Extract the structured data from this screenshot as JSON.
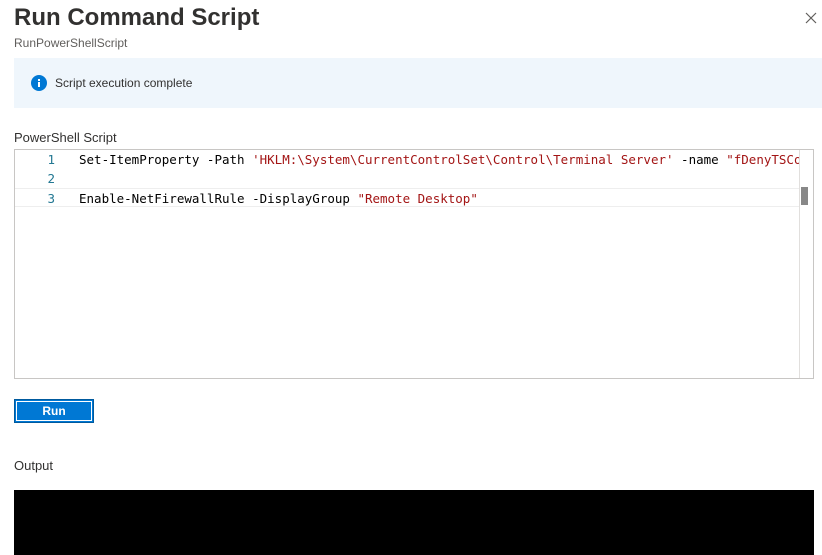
{
  "header": {
    "title": "Run Command Script",
    "subtitle": "RunPowerShellScript",
    "close_icon": "close-icon"
  },
  "banner": {
    "icon": "info-icon",
    "icon_color": "#0078d4",
    "message": "Script execution complete"
  },
  "script": {
    "label": "PowerShell Script",
    "lines": [
      {
        "number": "1",
        "cmd": "Set-ItemProperty -Path ",
        "str1": "'HKLM:\\System\\CurrentControlSet\\Control\\Terminal Server'",
        "mid": " -name ",
        "str2": "\"fDenyTSConnections\""
      },
      {
        "number": "2",
        "text": ""
      },
      {
        "number": "3",
        "cmd": "Enable-NetFirewallRule -DisplayGroup ",
        "str1": "\"Remote Desktop\""
      }
    ]
  },
  "run_button": {
    "label": "Run",
    "color": "#0078d4"
  },
  "output": {
    "label": "Output",
    "text": ""
  }
}
